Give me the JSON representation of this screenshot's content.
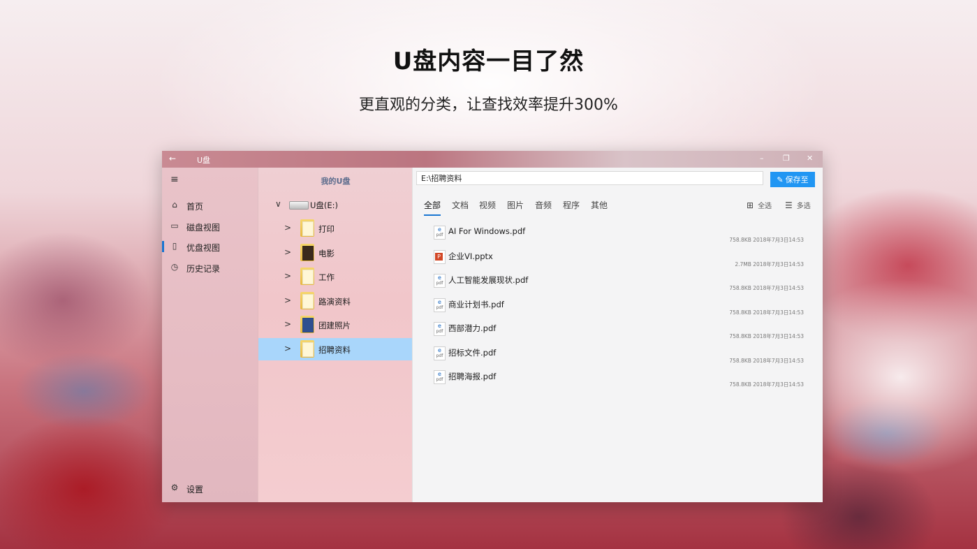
{
  "hero": {
    "title": "U盘内容一目了然",
    "subtitle": "更直观的分类，让查找效率提升300%"
  },
  "window": {
    "title": "U盘",
    "back_icon": "←",
    "minimize_icon": "–",
    "restore_icon": "❐",
    "close_icon": "✕"
  },
  "sidebar": {
    "menu_icon": "≡",
    "items": [
      {
        "label": "首页",
        "icon": "home-icon",
        "glyph": "⌂"
      },
      {
        "label": "磁盘视图",
        "icon": "disk-icon",
        "glyph": "▭"
      },
      {
        "label": "优盘视图",
        "icon": "usb-icon",
        "glyph": "▯"
      },
      {
        "label": "历史记录",
        "icon": "history-icon",
        "glyph": "◷"
      }
    ],
    "settings": {
      "label": "设置",
      "icon": "gear-icon",
      "glyph": "⚙"
    }
  },
  "tree": {
    "header": "我的U盘",
    "drive": {
      "label": "U盘(E:)",
      "chevron": "∨"
    },
    "folders": [
      {
        "label": "打印",
        "chevron": ">"
      },
      {
        "label": "电影",
        "chevron": ">"
      },
      {
        "label": "工作",
        "chevron": ">"
      },
      {
        "label": "路演资料",
        "chevron": ">"
      },
      {
        "label": "团建照片",
        "chevron": ">"
      },
      {
        "label": "招聘资料",
        "chevron": ">"
      }
    ],
    "selected_index": 5
  },
  "main": {
    "path": "E:\\招聘资料",
    "save_label": "保存至",
    "tabs": [
      "全部",
      "文档",
      "视频",
      "图片",
      "音频",
      "程序",
      "其他"
    ],
    "active_tab": 0,
    "select_all_label": "全选",
    "multi_select_label": "多选",
    "files": [
      {
        "name": "AI For Windows.pdf",
        "size": "758.8KB",
        "date": "2018年7月3日14:53",
        "type": "pdf"
      },
      {
        "name": "企业VI.pptx",
        "size": "2.7MB",
        "date": "2018年7月3日14:53",
        "type": "pptx"
      },
      {
        "name": "人工智能发展现状.pdf",
        "size": "758.8KB",
        "date": "2018年7月3日14:53",
        "type": "pdf"
      },
      {
        "name": "商业计划书.pdf",
        "size": "758.8KB",
        "date": "2018年7月3日14:53",
        "type": "pdf"
      },
      {
        "name": "西部潜力.pdf",
        "size": "758.8KB",
        "date": "2018年7月3日14:53",
        "type": "pdf"
      },
      {
        "name": "招标文件.pdf",
        "size": "758.8KB",
        "date": "2018年7月3日14:53",
        "type": "pdf"
      },
      {
        "name": "招聘海报.pdf",
        "size": "758.8KB",
        "date": "2018年7月3日14:53",
        "type": "pdf"
      }
    ]
  },
  "colors": {
    "accent": "#2196f3",
    "selection": "#a9d6fb"
  }
}
